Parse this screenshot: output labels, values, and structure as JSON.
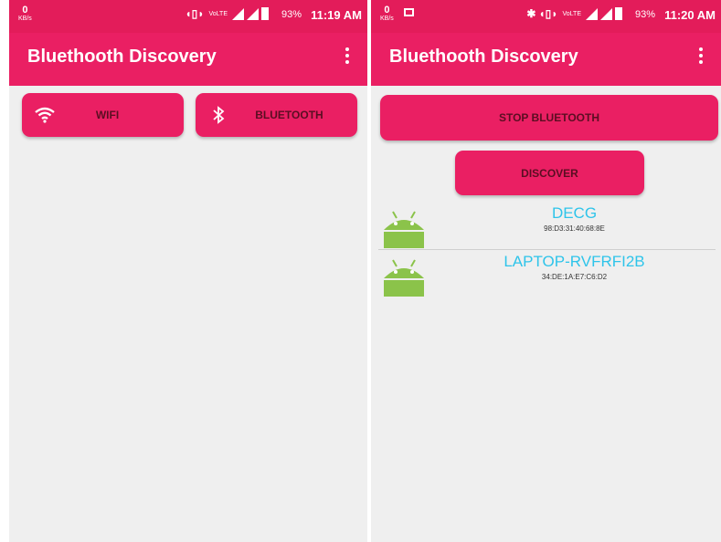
{
  "screens": [
    {
      "status": {
        "kb_top": "0",
        "kb_bottom": "KB/s",
        "volte": "VoLTE",
        "battery": "93%",
        "time": "11:19 AM"
      },
      "app_title": "Bluethooth Discovery",
      "buttons": {
        "wifi": "WIFI",
        "bluetooth": "BLUETOOTH"
      }
    },
    {
      "status": {
        "kb_top": "0",
        "kb_bottom": "KB/s",
        "volte": "VoLTE",
        "battery": "93%",
        "time": "11:20 AM"
      },
      "app_title": "Bluethooth Discovery",
      "buttons": {
        "stop_bluetooth": "STOP BLUETOOTH",
        "discover": "DISCOVER"
      },
      "devices": [
        {
          "name": "DECG",
          "address": "98:D3:31:40:68:8E",
          "icon": "android-robot-icon"
        },
        {
          "name": "LAPTOP-RVFRFI2B",
          "address": "34:DE:1A:E7:C6:D2",
          "icon": "android-robot-icon"
        }
      ]
    }
  ],
  "colors": {
    "status_bar": "#e31c5a",
    "app_bar": "#ea1f63",
    "button": "#ea1f63",
    "device_name": "#2ec4ea",
    "android_green": "#8bc34a"
  }
}
